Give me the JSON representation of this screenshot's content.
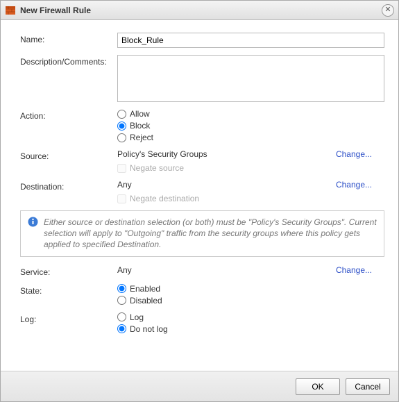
{
  "title": "New Firewall Rule",
  "fields": {
    "name_label": "Name:",
    "name_value": "Block_Rule",
    "desc_label": "Description/Comments:",
    "desc_value": "",
    "action_label": "Action:",
    "action_options": {
      "allow": "Allow",
      "block": "Block",
      "reject": "Reject"
    },
    "action_selected": "block",
    "source_label": "Source:",
    "source_value": "Policy's Security Groups",
    "negate_source_label": "Negate source",
    "destination_label": "Destination:",
    "destination_value": "Any",
    "negate_destination_label": "Negate destination",
    "change_link": "Change...",
    "service_label": "Service:",
    "service_value": "Any",
    "state_label": "State:",
    "state_options": {
      "enabled": "Enabled",
      "disabled": "Disabled"
    },
    "state_selected": "enabled",
    "log_label": "Log:",
    "log_options": {
      "log": "Log",
      "nolog": "Do not log"
    },
    "log_selected": "nolog"
  },
  "info_text": "Either source or destination selection (or both) must be \"Policy's Security Groups\". Current selection will apply to \"Outgoing\" traffic from the security groups where this policy gets applied to specified Destination.",
  "buttons": {
    "ok": "OK",
    "cancel": "Cancel"
  }
}
